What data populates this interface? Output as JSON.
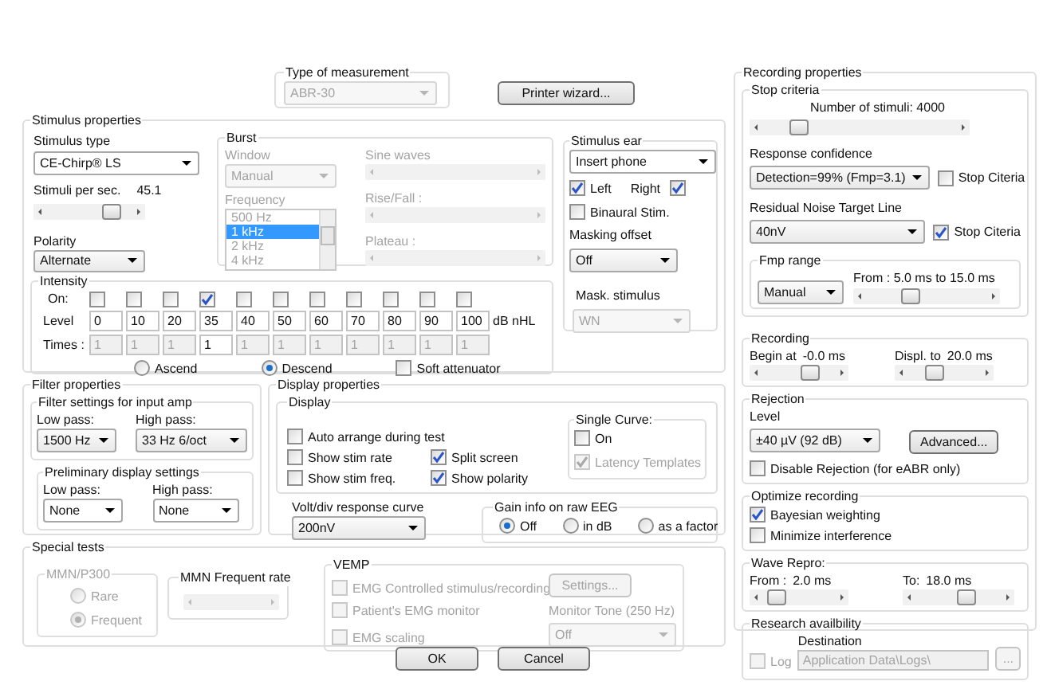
{
  "type_of_measurement": {
    "title": "Type of measurement",
    "value": "ABR-30",
    "disabled": true
  },
  "printer_wizard": {
    "label": "Printer wizard...",
    "disabled": false
  },
  "stimulus_properties": {
    "title": "Stimulus properties",
    "stimulus_type": {
      "label": "Stimulus type",
      "value": "CE-Chirp® LS"
    },
    "rate": {
      "label": "Stimuli per sec.",
      "reading": "45.1",
      "level": 0.74
    },
    "polarity": {
      "label": "Polarity",
      "value": "Alternate"
    },
    "burst": {
      "title": "Burst",
      "window": {
        "label": "Window",
        "value": "Manual",
        "disabled": true
      },
      "frequency": {
        "label": "Frequency",
        "disabled": true,
        "items": [
          {
            "label": "500 Hz",
            "selected": false
          },
          {
            "label": "1 kHz",
            "selected": true
          },
          {
            "label": "2 kHz",
            "selected": false
          },
          {
            "label": "4 kHz",
            "selected": false
          }
        ]
      },
      "sliders": [
        {
          "label": "Sine waves",
          "disabled": true
        },
        {
          "label": "Rise/Fall :",
          "disabled": true
        },
        {
          "label": "Plateau :",
          "disabled": true
        }
      ]
    },
    "intensity": {
      "title": "Intensity",
      "on_label": "On:",
      "level_label": "Level",
      "times_label": "Times :",
      "unit": "dB nHL",
      "steps": [
        {
          "on": false,
          "value": "0",
          "times": "1"
        },
        {
          "on": false,
          "value": "10",
          "times": "1"
        },
        {
          "on": false,
          "value": "20",
          "times": "1"
        },
        {
          "on": true,
          "value": "35",
          "times": "1"
        },
        {
          "on": false,
          "value": "40",
          "times": "1"
        },
        {
          "on": false,
          "value": "50",
          "times": "1"
        },
        {
          "on": false,
          "value": "60",
          "times": "1"
        },
        {
          "on": false,
          "value": "70",
          "times": "1"
        },
        {
          "on": false,
          "value": "80",
          "times": "1"
        },
        {
          "on": false,
          "value": "90",
          "times": "1"
        },
        {
          "on": false,
          "value": "100",
          "times": "1"
        }
      ],
      "order": [
        {
          "label": "Ascend",
          "selected": false
        },
        {
          "label": "Descend",
          "selected": true
        }
      ],
      "soft_attenuator": {
        "label": "Soft attenuator",
        "checked": false
      }
    },
    "stimulus_ear": {
      "title": "Stimulus ear",
      "transducer": {
        "value": "Insert phone"
      },
      "left": {
        "label": "Left",
        "checked": true
      },
      "right": {
        "label": "Right",
        "checked": true
      },
      "binaural": {
        "label": "Binaural Stim.",
        "checked": false
      },
      "masking_offset": {
        "label": "Masking offset",
        "value": "Off"
      },
      "mask_stimulus": {
        "label": "Mask. stimulus",
        "value": "WN",
        "disabled": true
      }
    }
  },
  "filter_properties": {
    "title": "Filter properties",
    "input_amp": {
      "title": "Filter settings for input amp",
      "low_pass": {
        "label": "Low pass:",
        "value": "1500 Hz"
      },
      "high_pass": {
        "label": "High pass:",
        "value": "33 Hz 6/oct"
      }
    },
    "preliminary": {
      "title": "Preliminary display settings",
      "low_pass": {
        "label": "Low pass:",
        "value": "None"
      },
      "high_pass": {
        "label": "High pass:",
        "value": "None"
      }
    }
  },
  "display_properties": {
    "title": "Display properties",
    "display": {
      "title": "Display",
      "checks": [
        {
          "label": "Auto arrange during test",
          "checked": false
        },
        {
          "label": "Show stim rate",
          "checked": false
        },
        {
          "label": "Show stim freq.",
          "checked": false
        },
        {
          "label": "Split screen",
          "checked": true
        },
        {
          "label": "Show polarity",
          "checked": true
        }
      ],
      "single_curve": {
        "title": "Single Curve:",
        "on": {
          "label": "On",
          "checked": false,
          "disabled": false
        },
        "latency_templates": {
          "label": "Latency Templates",
          "checked": true,
          "disabled": true
        }
      }
    },
    "volt_div": {
      "label": "Volt/div response curve",
      "value": "200nV"
    },
    "gain_info": {
      "title": "Gain info on raw EEG",
      "options": [
        {
          "label": "Off",
          "selected": true
        },
        {
          "label": "in dB",
          "selected": false
        },
        {
          "label": "as a factor",
          "selected": false
        }
      ]
    }
  },
  "special_tests": {
    "title": "Special tests",
    "mmn": {
      "title": "MMN/P300",
      "disabled": true,
      "options": [
        {
          "label": "Rare",
          "selected": false
        },
        {
          "label": "Frequent",
          "selected": true
        }
      ]
    },
    "mmn_rate": {
      "title": "MMN Frequent rate",
      "disabled": true
    },
    "vemp": {
      "title": "VEMP",
      "emg_controlled": {
        "label": "EMG Controlled stimulus/recording",
        "checked": false,
        "disabled": true
      },
      "settings": {
        "label": "Settings...",
        "disabled": true
      },
      "patient_monitor": {
        "label": "Patient's EMG monitor",
        "checked": false,
        "disabled": true
      },
      "monitor_tone": {
        "label": "Monitor Tone (250 Hz)",
        "value": "Off",
        "disabled": true
      },
      "emg_scaling": {
        "label": "EMG scaling",
        "checked": false,
        "disabled": true
      }
    }
  },
  "recording_properties": {
    "title": "Recording properties",
    "stop_criteria": {
      "title": "Stop criteria",
      "stimuli": {
        "label": "Number of stimuli:",
        "reading": "4000",
        "level": 0.2
      },
      "response_confidence": {
        "label": "Response confidence",
        "value": "Detection=99% (Fmp=3.1)",
        "stop": {
          "label": "Stop Citeria",
          "checked": false
        }
      },
      "residual_noise": {
        "label": "Residual Noise Target Line",
        "value": "40nV",
        "stop": {
          "label": "Stop Citeria",
          "checked": true
        }
      },
      "fmp_range": {
        "title": "Fmp range",
        "value": "Manual",
        "reading": "From : 5.0 ms to 15.0 ms",
        "level": 0.38
      }
    },
    "recording": {
      "title": "Recording",
      "begin": {
        "label": "Begin at",
        "reading": "-0.0 ms",
        "level": 0.64
      },
      "display_to": {
        "label": "Displ. to",
        "reading": "20.0 ms",
        "level": 0.38
      }
    },
    "rejection": {
      "title": "Rejection",
      "level_label": "Level",
      "value": "±40 µV (92 dB)",
      "advanced": {
        "label": "Advanced...",
        "disabled": false
      },
      "disable": {
        "label": "Disable Rejection (for eABR only)",
        "checked": false
      }
    },
    "optimize": {
      "title": "Optimize recording",
      "checks": [
        {
          "label": "Bayesian weighting",
          "checked": true
        },
        {
          "label": "Minimize interference",
          "checked": false
        }
      ]
    },
    "wave_repro": {
      "title": "Wave Repro:",
      "from": {
        "label": "From :",
        "reading": "2.0 ms",
        "level": 0.22
      },
      "to": {
        "label": "To:",
        "reading": "18.0 ms",
        "level": 0.58
      }
    },
    "research": {
      "title": "Research availbility",
      "log": {
        "label": "Log",
        "checked": false,
        "disabled": true
      },
      "destination": {
        "label": "Destination",
        "value": "Application Data\\Logs\\",
        "disabled": true
      },
      "browse": {
        "label": "...",
        "disabled": true
      }
    }
  },
  "buttons": [
    {
      "label": "OK"
    },
    {
      "label": "Cancel"
    }
  ]
}
